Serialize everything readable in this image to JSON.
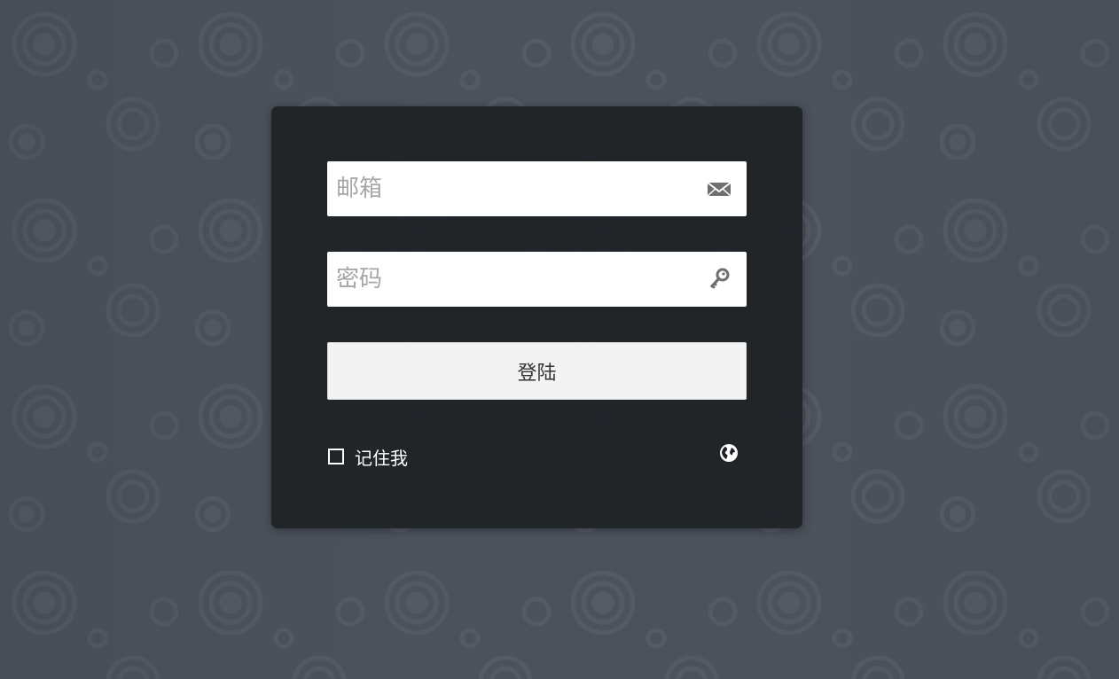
{
  "login": {
    "email": {
      "placeholder": "邮箱",
      "value": "",
      "icon": "envelope-icon"
    },
    "password": {
      "placeholder": "密码",
      "value": "",
      "icon": "key-icon"
    },
    "submit_label": "登陆",
    "remember": {
      "label": "记住我",
      "checked": false
    },
    "language_icon": "globe-icon"
  },
  "colors": {
    "background": "#4b525b",
    "panel": "#1e2125",
    "button": "#f3f3f3"
  }
}
